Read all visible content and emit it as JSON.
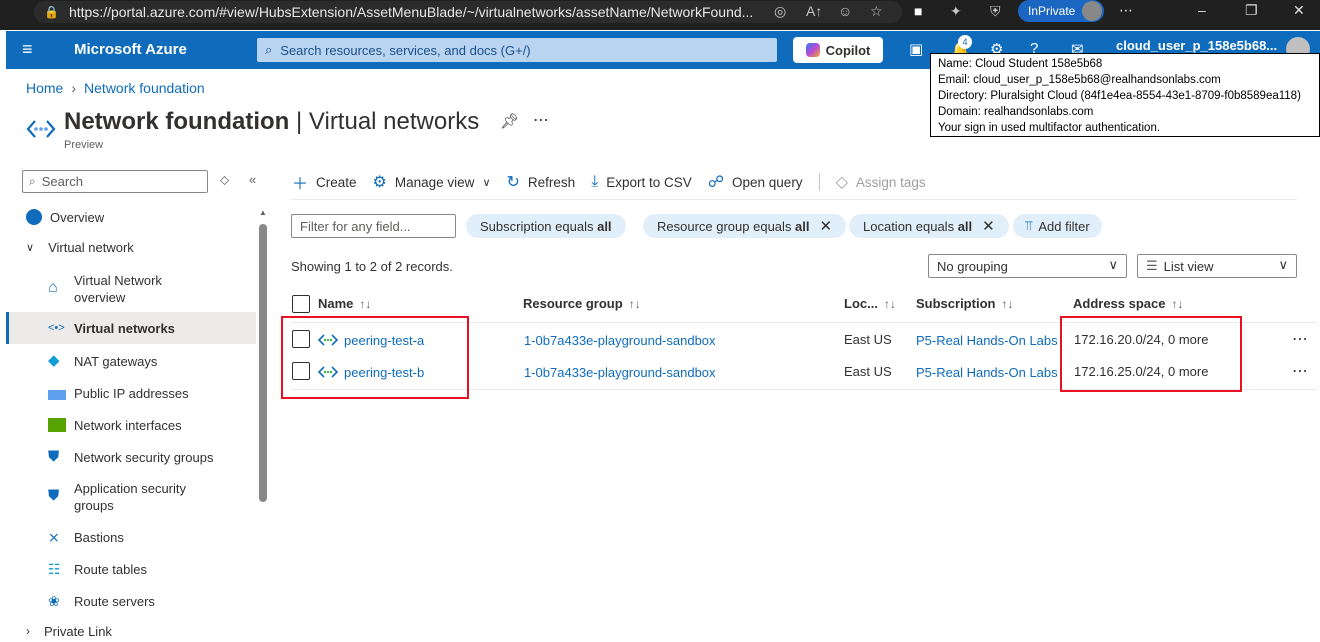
{
  "browser": {
    "url": "https://portal.azure.com/#view/HubsExtension/AssetMenuBlade/~/virtualnetworks/assetName/NetworkFound...",
    "inprivate_label": "InPrivate",
    "extension_badge": "4"
  },
  "header": {
    "brand": "Microsoft Azure",
    "search_placeholder": "Search resources, services, and docs (G+/)",
    "copilot_label": "Copilot",
    "notification_count": "4",
    "user": "cloud_user_p_158e5b68..."
  },
  "tooltip": {
    "line1": "Name: Cloud Student 158e5b68",
    "line2": "Email: cloud_user_p_158e5b68@realhandsonlabs.com",
    "line3": "Directory: Pluralsight Cloud (84f1e4ea-8554-43e1-8709-f0b8589ea118)",
    "line4": "Domain: realhandsonlabs.com",
    "line5": "Your sign in used multifactor authentication."
  },
  "breadcrumb": {
    "home": "Home",
    "current": "Network foundation"
  },
  "page": {
    "title_bold": "Network foundation",
    "title_sep": " | ",
    "title_rest": "Virtual networks",
    "subtitle": "Preview"
  },
  "nav": {
    "search_placeholder": "Search",
    "items": [
      {
        "label": "Overview"
      },
      {
        "label": "Virtual network"
      },
      {
        "label": "Virtual Network overview"
      },
      {
        "label": "Virtual networks"
      },
      {
        "label": "NAT gateways"
      },
      {
        "label": "Public IP addresses"
      },
      {
        "label": "Network interfaces"
      },
      {
        "label": "Network security groups"
      },
      {
        "label": "Application security groups"
      },
      {
        "label": "Bastions"
      },
      {
        "label": "Route tables"
      },
      {
        "label": "Route servers"
      },
      {
        "label": "Private Link"
      }
    ]
  },
  "toolbar": {
    "create": "Create",
    "manage_view": "Manage view",
    "refresh": "Refresh",
    "export_csv": "Export to CSV",
    "open_query": "Open query",
    "assign_tags": "Assign tags"
  },
  "filters": {
    "placeholder": "Filter for any field...",
    "subscription_prefix": "Subscription equals ",
    "subscription_value": "all",
    "resource_group_prefix": "Resource group equals ",
    "resource_group_value": "all",
    "location_prefix": "Location equals ",
    "location_value": "all",
    "add_filter": "Add filter"
  },
  "records_text": "Showing 1 to 2 of 2 records.",
  "grouping_select": "No grouping",
  "view_select": "List view",
  "table": {
    "headers": {
      "name": "Name",
      "resource_group": "Resource group",
      "location": "Loc...",
      "subscription": "Subscription",
      "address_space": "Address space"
    },
    "rows": [
      {
        "name": "peering-test-a",
        "resource_group": "1-0b7a433e-playground-sandbox",
        "location": "East US",
        "subscription": "P5-Real Hands-On Labs",
        "address_space": "172.16.20.0/24, 0 more"
      },
      {
        "name": "peering-test-b",
        "resource_group": "1-0b7a433e-playground-sandbox",
        "location": "East US",
        "subscription": "P5-Real Hands-On Labs",
        "address_space": "172.16.25.0/24, 0 more"
      }
    ]
  },
  "colors": {
    "azure_blue": "#0f6cbd",
    "highlight_red": "#e81123",
    "pill_bg": "#e1effa"
  }
}
